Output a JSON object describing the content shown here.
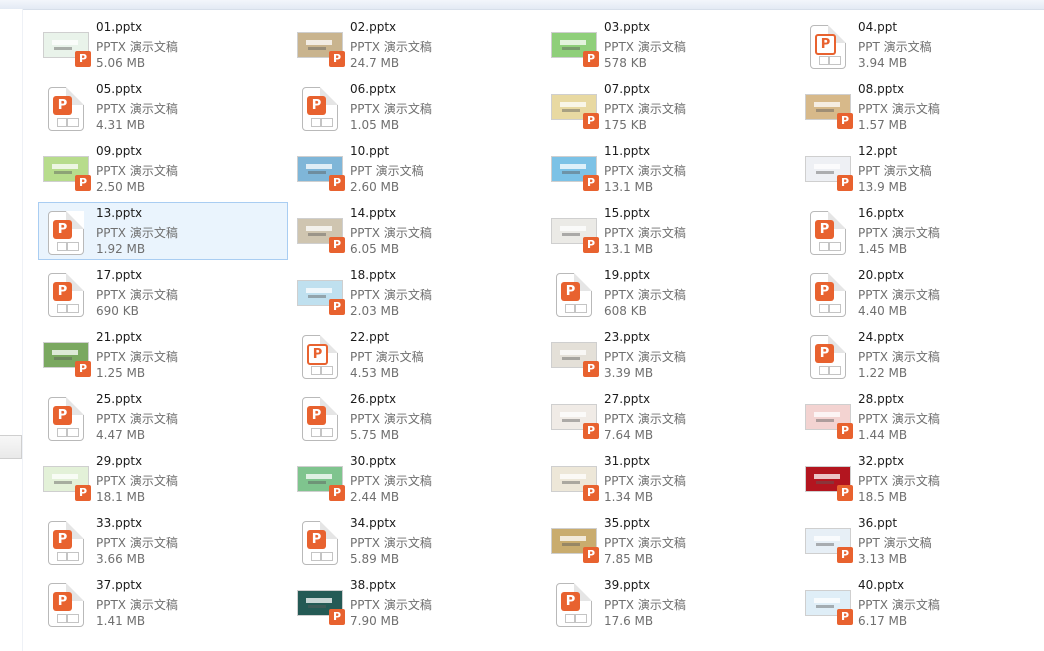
{
  "colors": {
    "accent": "#e8622f",
    "selection": "#eaf4fd",
    "selection_border": "#a9cdf2"
  },
  "files": [
    {
      "name": "01.pptx",
      "type": "PPTX 演示文稿",
      "size": "5.06 MB",
      "icon": "slide-thumbnail",
      "thumb": "#e9f3ea"
    },
    {
      "name": "02.pptx",
      "type": "PPTX 演示文稿",
      "size": "24.7 MB",
      "icon": "slide-thumbnail",
      "thumb": "#c9b48e"
    },
    {
      "name": "03.pptx",
      "type": "PPTX 演示文稿",
      "size": "578 KB",
      "icon": "slide-thumbnail",
      "thumb": "#8fcf7a"
    },
    {
      "name": "04.ppt",
      "type": "PPT 演示文稿",
      "size": "3.94 MB",
      "icon": "ppt-file-icon"
    },
    {
      "name": "05.pptx",
      "type": "PPTX 演示文稿",
      "size": "4.31 MB",
      "icon": "pptx-file-icon"
    },
    {
      "name": "06.pptx",
      "type": "PPTX 演示文稿",
      "size": "1.05 MB",
      "icon": "pptx-file-icon"
    },
    {
      "name": "07.pptx",
      "type": "PPTX 演示文稿",
      "size": "175 KB",
      "icon": "slide-thumbnail",
      "thumb": "#e8d9a2"
    },
    {
      "name": "08.pptx",
      "type": "PPTX 演示文稿",
      "size": "1.57 MB",
      "icon": "slide-thumbnail",
      "thumb": "#d7b98a"
    },
    {
      "name": "09.pptx",
      "type": "PPTX 演示文稿",
      "size": "2.50 MB",
      "icon": "slide-thumbnail",
      "thumb": "#b7dc8c"
    },
    {
      "name": "10.ppt",
      "type": "PPT 演示文稿",
      "size": "2.60 MB",
      "icon": "slide-thumbnail",
      "thumb": "#7fb6d8"
    },
    {
      "name": "11.pptx",
      "type": "PPTX 演示文稿",
      "size": "13.1 MB",
      "icon": "slide-thumbnail",
      "thumb": "#7cc2e6"
    },
    {
      "name": "12.ppt",
      "type": "PPT 演示文稿",
      "size": "13.9 MB",
      "icon": "slide-thumbnail",
      "thumb": "#eef0f4"
    },
    {
      "name": "13.pptx",
      "type": "PPTX 演示文稿",
      "size": "1.92 MB",
      "icon": "pptx-file-icon",
      "selected": true
    },
    {
      "name": "14.pptx",
      "type": "PPTX 演示文稿",
      "size": "6.05 MB",
      "icon": "slide-thumbnail",
      "thumb": "#cfc5b0"
    },
    {
      "name": "15.pptx",
      "type": "PPTX 演示文稿",
      "size": "13.1 MB",
      "icon": "slide-thumbnail",
      "thumb": "#ebeae6"
    },
    {
      "name": "16.pptx",
      "type": "PPTX 演示文稿",
      "size": "1.45 MB",
      "icon": "pptx-file-icon"
    },
    {
      "name": "17.pptx",
      "type": "PPTX 演示文稿",
      "size": "690 KB",
      "icon": "pptx-file-icon"
    },
    {
      "name": "18.pptx",
      "type": "PPTX 演示文稿",
      "size": "2.03 MB",
      "icon": "slide-thumbnail",
      "thumb": "#bfe0ef"
    },
    {
      "name": "19.pptx",
      "type": "PPTX 演示文稿",
      "size": "608 KB",
      "icon": "pptx-file-icon"
    },
    {
      "name": "20.pptx",
      "type": "PPTX 演示文稿",
      "size": "4.40 MB",
      "icon": "pptx-file-icon"
    },
    {
      "name": "21.pptx",
      "type": "PPTX 演示文稿",
      "size": "1.25 MB",
      "icon": "slide-thumbnail",
      "thumb": "#7aa860"
    },
    {
      "name": "22.ppt",
      "type": "PPT 演示文稿",
      "size": "4.53 MB",
      "icon": "ppt-file-icon"
    },
    {
      "name": "23.pptx",
      "type": "PPTX 演示文稿",
      "size": "3.39 MB",
      "icon": "slide-thumbnail",
      "thumb": "#e4e0d8"
    },
    {
      "name": "24.pptx",
      "type": "PPTX 演示文稿",
      "size": "1.22 MB",
      "icon": "pptx-file-icon"
    },
    {
      "name": "25.pptx",
      "type": "PPTX 演示文稿",
      "size": "4.47 MB",
      "icon": "pptx-file-icon"
    },
    {
      "name": "26.pptx",
      "type": "PPTX 演示文稿",
      "size": "5.75 MB",
      "icon": "pptx-file-icon"
    },
    {
      "name": "27.pptx",
      "type": "PPTX 演示文稿",
      "size": "7.64 MB",
      "icon": "slide-thumbnail",
      "thumb": "#f0ebe6"
    },
    {
      "name": "28.pptx",
      "type": "PPTX 演示文稿",
      "size": "1.44 MB",
      "icon": "slide-thumbnail",
      "thumb": "#f3d3d1"
    },
    {
      "name": "29.pptx",
      "type": "PPTX 演示文稿",
      "size": "18.1 MB",
      "icon": "slide-thumbnail",
      "thumb": "#e3f1d8"
    },
    {
      "name": "30.pptx",
      "type": "PPTX 演示文稿",
      "size": "2.44 MB",
      "icon": "slide-thumbnail",
      "thumb": "#7fc48e"
    },
    {
      "name": "31.pptx",
      "type": "PPTX 演示文稿",
      "size": "1.34 MB",
      "icon": "slide-thumbnail",
      "thumb": "#ede7d8"
    },
    {
      "name": "32.pptx",
      "type": "PPTX 演示文稿",
      "size": "18.5 MB",
      "icon": "slide-thumbnail",
      "thumb": "#b3151f"
    },
    {
      "name": "33.pptx",
      "type": "PPTX 演示文稿",
      "size": "3.66 MB",
      "icon": "pptx-file-icon"
    },
    {
      "name": "34.pptx",
      "type": "PPTX 演示文稿",
      "size": "5.89 MB",
      "icon": "pptx-file-icon"
    },
    {
      "name": "35.pptx",
      "type": "PPTX 演示文稿",
      "size": "7.85 MB",
      "icon": "slide-thumbnail",
      "thumb": "#c9ac6e"
    },
    {
      "name": "36.ppt",
      "type": "PPT 演示文稿",
      "size": "3.13 MB",
      "icon": "slide-thumbnail",
      "thumb": "#e7eff6"
    },
    {
      "name": "37.pptx",
      "type": "PPTX 演示文稿",
      "size": "1.41 MB",
      "icon": "pptx-file-icon"
    },
    {
      "name": "38.pptx",
      "type": "PPTX 演示文稿",
      "size": "7.90 MB",
      "icon": "slide-thumbnail",
      "thumb": "#245a55"
    },
    {
      "name": "39.pptx",
      "type": "PPTX 演示文稿",
      "size": "17.6 MB",
      "icon": "pptx-file-icon"
    },
    {
      "name": "40.pptx",
      "type": "PPTX 演示文稿",
      "size": "6.17 MB",
      "icon": "slide-thumbnail",
      "thumb": "#dfeef7"
    }
  ]
}
